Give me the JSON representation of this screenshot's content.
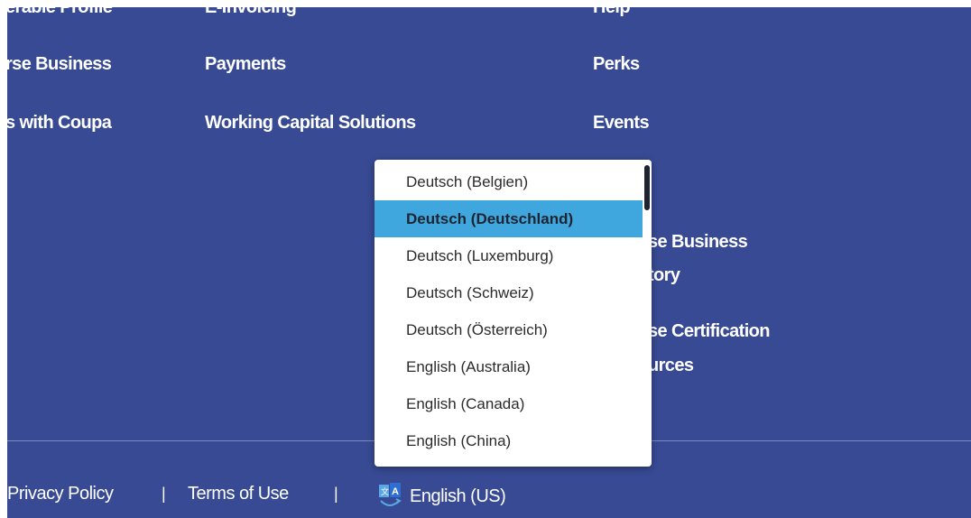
{
  "nav": {
    "col1": [
      "erable Profile",
      "rse Business",
      "s with Coupa"
    ],
    "col2": [
      "E-Invoicing",
      "Payments",
      "Working Capital Solutions"
    ],
    "col3": [
      "Help",
      "Perks",
      "Events"
    ],
    "partial": [
      "se Business",
      "tory",
      "se Certification",
      "urces"
    ]
  },
  "footer": {
    "privacy": "Privacy Policy",
    "sep": "|",
    "terms": "Terms of Use",
    "language": "English (US)"
  },
  "language_dropdown": {
    "options": [
      "Deutsch (Belgien)",
      "Deutsch (Deutschland)",
      "Deutsch (Luxemburg)",
      "Deutsch (Schweiz)",
      "Deutsch (Österreich)",
      "English (Australia)",
      "English (Canada)",
      "English (China)"
    ],
    "selected": "Deutsch (Deutschland)"
  },
  "colors": {
    "background": "#374a93",
    "highlight": "#3fa7dd",
    "text": "#ffffff"
  }
}
